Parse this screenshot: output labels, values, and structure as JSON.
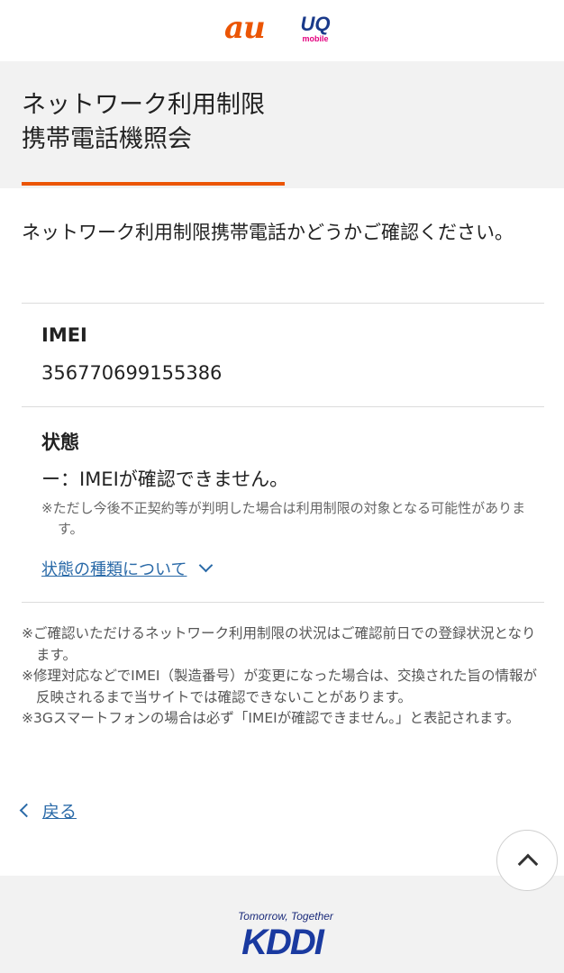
{
  "header": {
    "au_logo": "au",
    "uq_logo": "UQ",
    "uq_sub": "mobile",
    "brand_color": "#eb5505"
  },
  "page": {
    "title_line1": "ネットワーク利用制限",
    "title_line2": "携帯電話機照会"
  },
  "intro": "ネットワーク利用制限携帯電話かどうかご確認ください。",
  "imei": {
    "label": "IMEI",
    "value": "356770699155386"
  },
  "status": {
    "label": "状態",
    "value": "ー：IMEIが確認できません。",
    "note": "※ただし今後不正契約等が判明した場合は利用制限の対象となる可能性があります。",
    "link": "状態の種類について"
  },
  "notes": [
    "※ご確認いただけるネットワーク利用制限の状況はご確認前日での登録状況となります。",
    "※修理対応などでIMEI（製造番号）が変更になった場合は、交換された旨の情報が反映されるまで当サイトでは確認できないことがあります。",
    "※3Gスマートフォンの場合は必ず「IMEIが確認できません。」と表記されます。"
  ],
  "back_label": "戻る",
  "footer": {
    "tagline": "Tomorrow, Together",
    "logo": "KDDI"
  },
  "icons": {
    "chevron_down": "chevron-down-icon",
    "chevron_left": "chevron-left-icon",
    "chevron_up": "chevron-up-icon"
  }
}
